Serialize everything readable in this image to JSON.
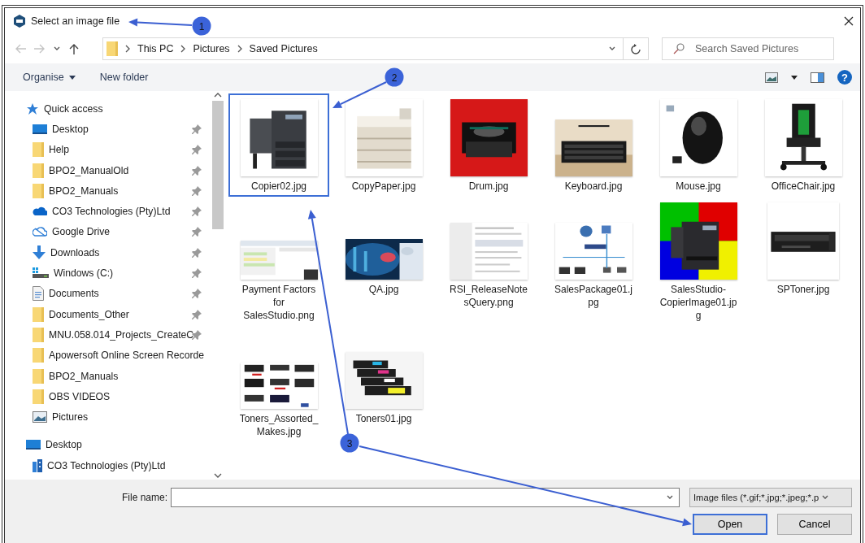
{
  "window": {
    "title": "Select an image file"
  },
  "history": {
    "back": {
      "disabled": true
    },
    "forward": {
      "disabled": true
    },
    "up": {
      "disabled": false
    }
  },
  "address": {
    "path": [
      "This PC",
      "Pictures",
      "Saved Pictures"
    ]
  },
  "search": {
    "placeholder": "Search Saved Pictures"
  },
  "toolbar": {
    "organise": "Organise",
    "new_folder": "New folder",
    "help": "?"
  },
  "nav": [
    {
      "label": "Quick access",
      "kind": "star",
      "children": [
        {
          "label": "Desktop",
          "kind": "desktop",
          "pinned": true
        },
        {
          "label": "Help",
          "kind": "folder",
          "pinned": true
        },
        {
          "label": "BPO2_ManualOld",
          "kind": "folder",
          "pinned": true
        },
        {
          "label": "BPO2_Manuals",
          "kind": "folder",
          "pinned": true
        },
        {
          "label": "CO3 Technologies (Pty)Ltd",
          "kind": "onedrive",
          "pinned": true
        },
        {
          "label": "Google Drive",
          "kind": "gdrive",
          "pinned": true
        },
        {
          "label": "Downloads",
          "kind": "download",
          "pinned": true
        },
        {
          "label": "Windows (C:)",
          "kind": "drive",
          "pinned": true
        },
        {
          "label": "Documents",
          "kind": "documents",
          "pinned": true
        },
        {
          "label": "Documents_Other",
          "kind": "folder",
          "pinned": true
        },
        {
          "label": "MNU.058.014_Projects_CreateC",
          "kind": "folder",
          "pinned": true
        },
        {
          "label": "Apowersoft Online Screen Recorde",
          "kind": "folder",
          "pinned": false
        },
        {
          "label": "BPO2_Manuals",
          "kind": "folder",
          "pinned": false
        },
        {
          "label": "OBS VIDEOS",
          "kind": "folder",
          "pinned": false
        },
        {
          "label": "Pictures",
          "kind": "pictures",
          "pinned": false
        }
      ]
    },
    {
      "label": "Desktop",
      "kind": "desktop",
      "children": [
        {
          "label": "CO3 Technologies (Pty)Ltd",
          "kind": "building",
          "pinned": false
        }
      ]
    }
  ],
  "files": [
    {
      "name": "Copier02.jpg",
      "selected": true
    },
    {
      "name": "CopyPaper.jpg",
      "selected": false
    },
    {
      "name": "Drum.jpg",
      "selected": false
    },
    {
      "name": "Keyboard.jpg",
      "selected": false
    },
    {
      "name": "Mouse.jpg",
      "selected": false
    },
    {
      "name": "OfficeChair.jpg",
      "selected": false
    },
    {
      "name": "Payment Factors for SalesStudio.png",
      "selected": false
    },
    {
      "name": "QA.jpg",
      "selected": false
    },
    {
      "name": "RSI_ReleaseNotesQuery.png",
      "selected": false
    },
    {
      "name": "SalesPackage01.jpg",
      "selected": false
    },
    {
      "name": "SalesStudio-CopierImage01.jpg",
      "selected": false
    },
    {
      "name": "SPToner.jpg",
      "selected": false
    },
    {
      "name": "Toners_Assorted_Makes.jpg",
      "selected": false
    },
    {
      "name": "Toners01.jpg",
      "selected": false
    }
  ],
  "file_name": {
    "label": "File name:"
  },
  "filter": "Image files (*.gif;*.jpg;*.jpeg;*.p",
  "buttons": [
    {
      "label": "Open",
      "kind": "primary"
    },
    {
      "label": "Cancel",
      "kind": "secondary"
    }
  ],
  "callouts": [
    {
      "label": "1"
    },
    {
      "label": "2"
    },
    {
      "label": "3"
    }
  ]
}
